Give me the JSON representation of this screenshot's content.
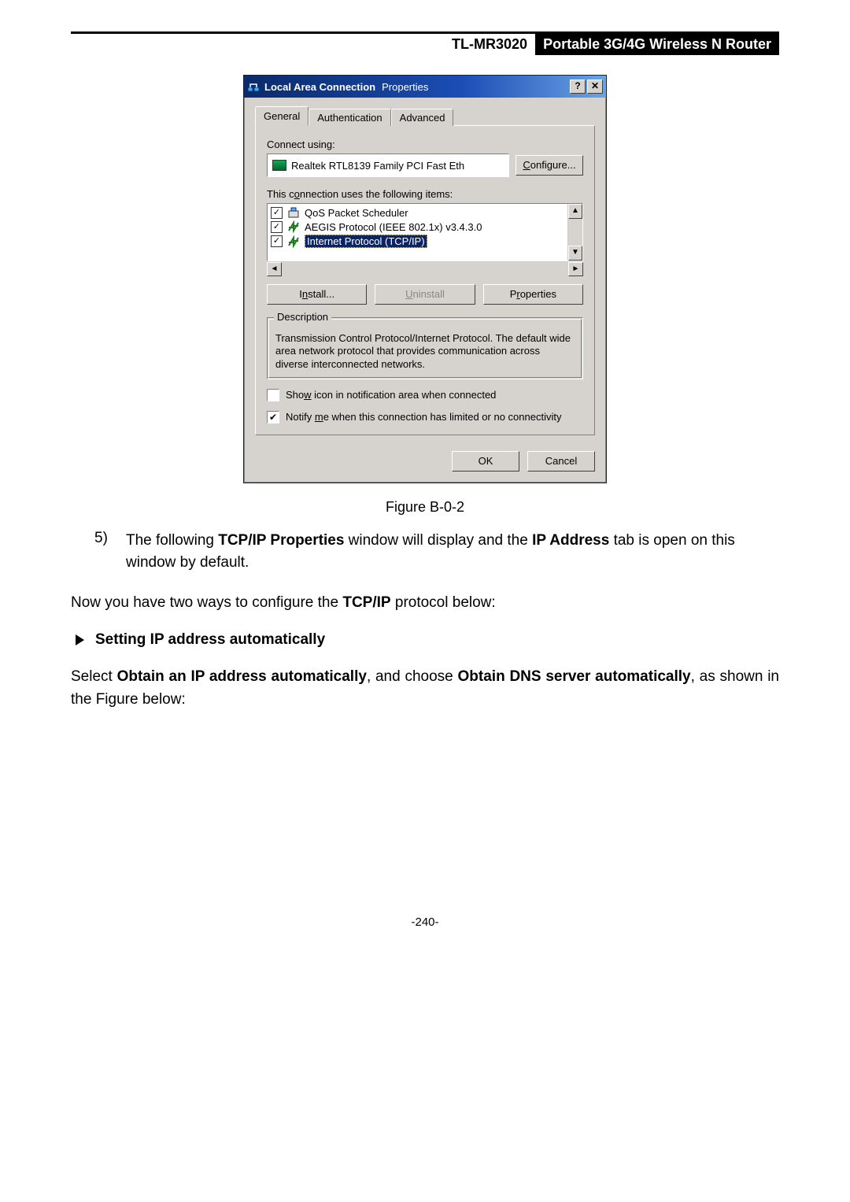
{
  "header": {
    "model": "TL-MR3020",
    "product": "Portable 3G/4G Wireless N Router"
  },
  "dialog": {
    "title_a": "Local Area Connection",
    "title_b": "Properties",
    "help_btn": "?",
    "close_btn": "✕",
    "tabs": [
      "General",
      "Authentication",
      "Advanced"
    ],
    "connect_using_label": "Connect using:",
    "adapter": "Realtek RTL8139 Family PCI Fast Eth",
    "configure_btn": "Configure...",
    "items_label": "This connection uses the following items:",
    "items": [
      {
        "checked": true,
        "label": "QoS Packet Scheduler",
        "selected": false
      },
      {
        "checked": true,
        "label": "AEGIS Protocol (IEEE 802.1x) v3.4.3.0",
        "selected": false
      },
      {
        "checked": true,
        "label": "Internet Protocol (TCP/IP)",
        "selected": true
      }
    ],
    "install_btn": "Install...",
    "uninstall_btn": "Uninstall",
    "properties_btn": "Properties",
    "group_title": "Description",
    "description": "Transmission Control Protocol/Internet Protocol. The default wide area network protocol that provides communication across diverse interconnected networks.",
    "show_icon": {
      "checked": false,
      "label": "Show icon in notification area when connected"
    },
    "notify": {
      "checked": true,
      "label": "Notify me when this connection has limited or no connectivity"
    },
    "ok_btn": "OK",
    "cancel_btn": "Cancel"
  },
  "figure_caption": "Figure B-0-2",
  "step5": {
    "num": "5)",
    "pre": "The following ",
    "bold1": "TCP/IP Properties",
    "mid": " window will display and the ",
    "bold2": "IP Address",
    "post": " tab is open on this window by default."
  },
  "line_twoway": {
    "pre": "Now you have two ways to configure the ",
    "bold": "TCP/IP",
    "post": " protocol below:"
  },
  "heading_auto": "Setting IP address automatically",
  "line_select": {
    "pre": "Select ",
    "bold1": "Obtain an IP address automatically",
    "mid": ", and choose ",
    "bold2": "Obtain DNS server automatically",
    "post": ", as shown in the Figure below:"
  },
  "page_number": "-240-"
}
